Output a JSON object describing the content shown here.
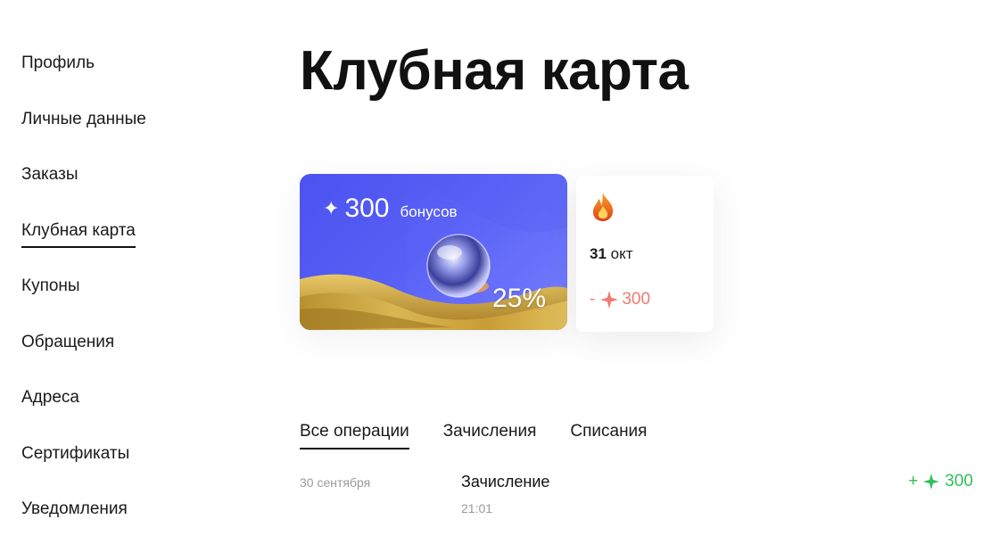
{
  "sidebar": {
    "items": [
      {
        "label": "Профиль"
      },
      {
        "label": "Личные данные"
      },
      {
        "label": "Заказы"
      },
      {
        "label": "Клубная карта",
        "active": true
      },
      {
        "label": "Купоны"
      },
      {
        "label": "Обращения"
      },
      {
        "label": "Адреса"
      },
      {
        "label": "Сертификаты"
      },
      {
        "label": "Уведомления"
      }
    ]
  },
  "main": {
    "title": "Клубная карта",
    "card": {
      "spark_icon": "sparkle-icon",
      "bonus_amount": "300",
      "bonus_word": "бонусов",
      "discount": "25%"
    },
    "expiry": {
      "icon": "fire-icon",
      "day": "31",
      "month": "окт",
      "sign": "-",
      "amount": "300",
      "color": "#ef7a70"
    },
    "tabs": [
      {
        "label": "Все операции",
        "active": true
      },
      {
        "label": "Зачисления"
      },
      {
        "label": "Списания"
      }
    ],
    "operations": [
      {
        "date": "30 сентября",
        "title": "Зачисление",
        "time": "21:01",
        "sign": "+",
        "amount": "300",
        "color": "#2fc05a"
      }
    ]
  }
}
